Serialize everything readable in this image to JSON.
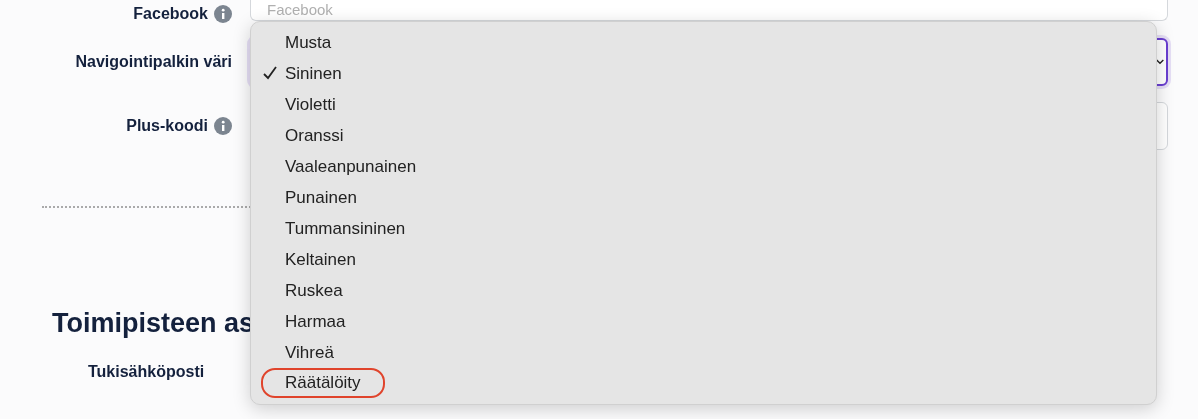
{
  "fields": [
    {
      "kind": "text",
      "label": "Facebook",
      "info": true,
      "placeholder": "Facebook",
      "focused": false
    },
    {
      "kind": "select",
      "label": "Navigointipalkin väri",
      "info": false,
      "focused": true
    },
    {
      "kind": "text",
      "label": "Plus-koodi",
      "info": true,
      "focused": false
    }
  ],
  "section": {
    "heading": "Toimipisteen as",
    "next_label": "Tukisähköposti"
  },
  "menu": {
    "options": [
      {
        "label": "Musta",
        "selected": false,
        "circled": false
      },
      {
        "label": "Sininen",
        "selected": true,
        "circled": false
      },
      {
        "label": "Violetti",
        "selected": false,
        "circled": false
      },
      {
        "label": "Oranssi",
        "selected": false,
        "circled": false
      },
      {
        "label": "Vaaleanpunainen",
        "selected": false,
        "circled": false
      },
      {
        "label": "Punainen",
        "selected": false,
        "circled": false
      },
      {
        "label": "Tummansininen",
        "selected": false,
        "circled": false
      },
      {
        "label": "Keltainen",
        "selected": false,
        "circled": false
      },
      {
        "label": "Ruskea",
        "selected": false,
        "circled": false
      },
      {
        "label": "Harmaa",
        "selected": false,
        "circled": false
      },
      {
        "label": "Vihreä",
        "selected": false,
        "circled": false
      },
      {
        "label": "Räätälöity",
        "selected": false,
        "circled": true
      }
    ]
  }
}
